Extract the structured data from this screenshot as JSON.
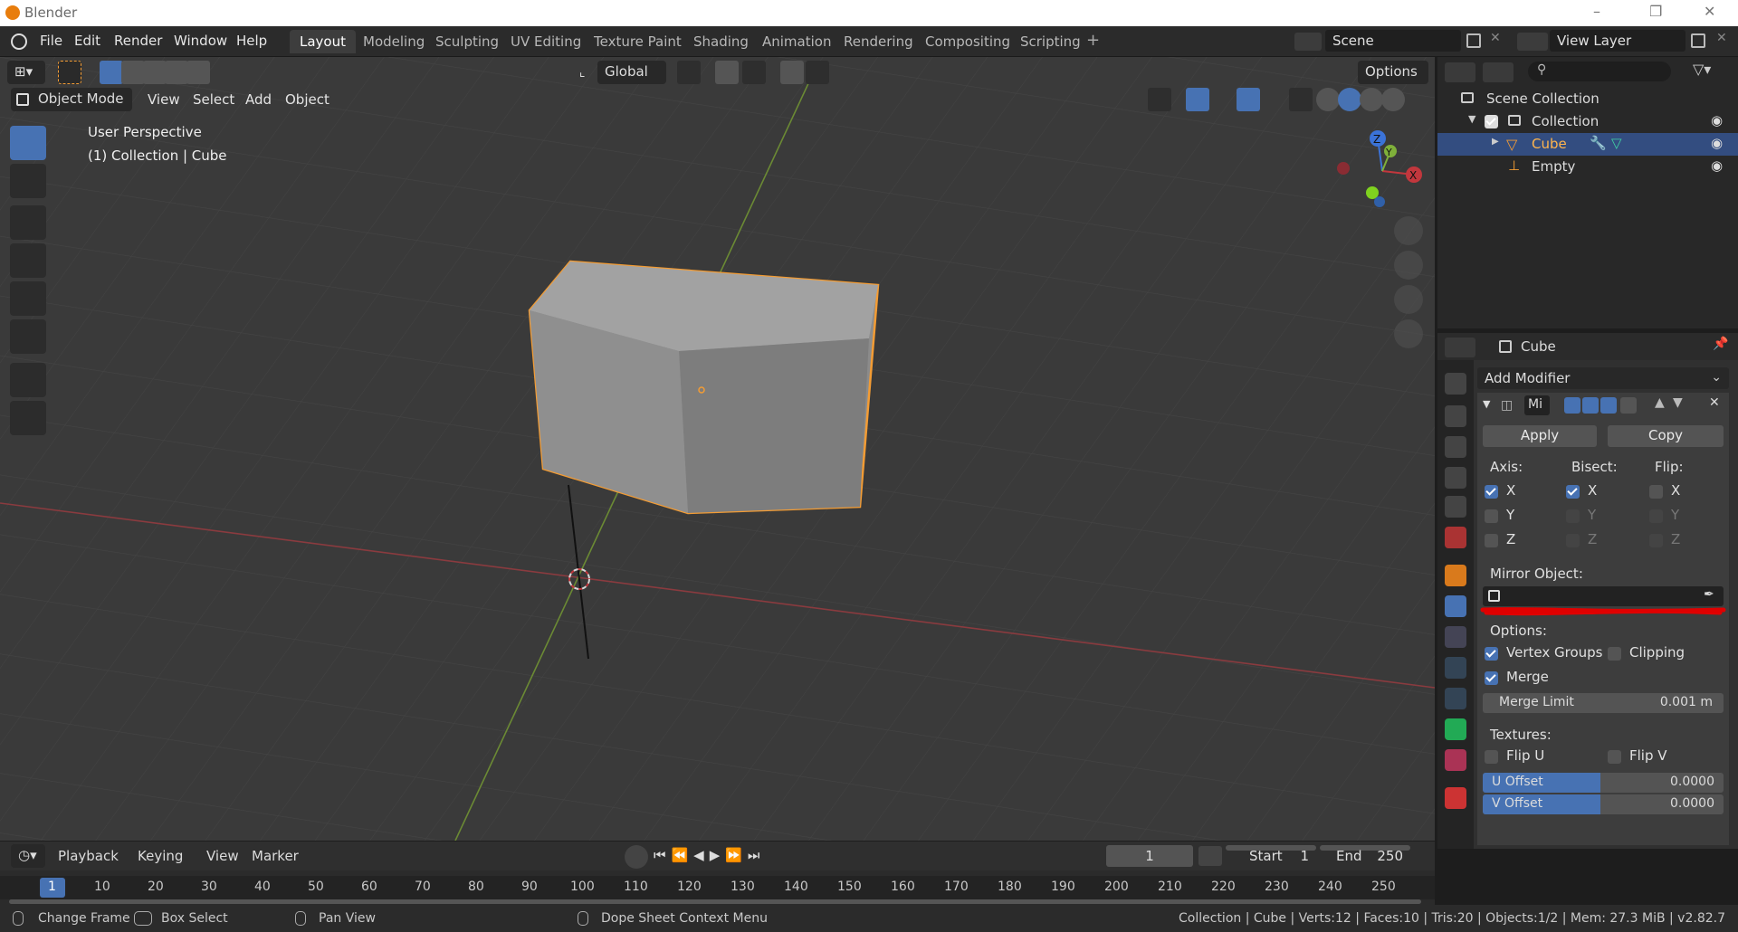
{
  "window": {
    "title": "Blender"
  },
  "menu": [
    "File",
    "Edit",
    "Render",
    "Window",
    "Help"
  ],
  "workspaces": [
    "Layout",
    "Modeling",
    "Sculpting",
    "UV Editing",
    "Texture Paint",
    "Shading",
    "Animation",
    "Rendering",
    "Compositing",
    "Scripting"
  ],
  "active_workspace": "Layout",
  "scene": "Scene",
  "view_layer": "View Layer",
  "viewport": {
    "mode": "Object Mode",
    "menus": [
      "View",
      "Select",
      "Add",
      "Object"
    ],
    "transform_orientation": "Global",
    "options_label": "Options",
    "info_line1": "User Perspective",
    "info_line2": "(1) Collection | Cube",
    "gizmo_labels": {
      "x": "X",
      "y": "Y",
      "z": "Z"
    }
  },
  "outliner": {
    "scene_collection": "Scene Collection",
    "collection": "Collection",
    "cube": "Cube",
    "empty": "Empty"
  },
  "properties": {
    "object_name": "Cube",
    "add_modifier": "Add Modifier",
    "modifier_name": "Mi",
    "apply": "Apply",
    "copy": "Copy",
    "axis_label": "Axis:",
    "bisect_label": "Bisect:",
    "flip_label": "Flip:",
    "x": "X",
    "y": "Y",
    "z": "Z",
    "mirror_object_label": "Mirror Object:",
    "options_label": "Options:",
    "vertex_groups": "Vertex Groups",
    "clipping": "Clipping",
    "merge": "Merge",
    "merge_limit_label": "Merge Limit",
    "merge_limit_value": "0.001 m",
    "textures_label": "Textures:",
    "flip_u": "Flip U",
    "flip_v": "Flip V",
    "u_offset_label": "U Offset",
    "u_offset_value": "0.0000",
    "v_offset_label": "V Offset",
    "v_offset_value": "0.0000"
  },
  "timeline": {
    "menus": [
      "Playback",
      "Keying",
      "View",
      "Marker"
    ],
    "current_frame": "1",
    "start_label": "Start",
    "start_value": "1",
    "end_label": "End",
    "end_value": "250",
    "ruler": [
      "1",
      "10",
      "20",
      "30",
      "40",
      "50",
      "60",
      "70",
      "80",
      "90",
      "100",
      "110",
      "120",
      "130",
      "140",
      "150",
      "160",
      "170",
      "180",
      "190",
      "200",
      "210",
      "220",
      "230",
      "240",
      "250"
    ]
  },
  "statusbar": {
    "change_frame": "Change Frame",
    "box_select": "Box Select",
    "pan_view": "Pan View",
    "context_menu": "Dope Sheet Context Menu",
    "stats": "Collection | Cube | Verts:12 | Faces:10 | Tris:20 | Objects:1/2 | Mem: 27.3 MiB | v2.82.7"
  },
  "colors": {
    "accent": "#4772b3",
    "selection_outline": "#f39c34",
    "x_axis": "#c2373d",
    "y_axis": "#7fb03a",
    "z_axis": "#3b73d8"
  }
}
